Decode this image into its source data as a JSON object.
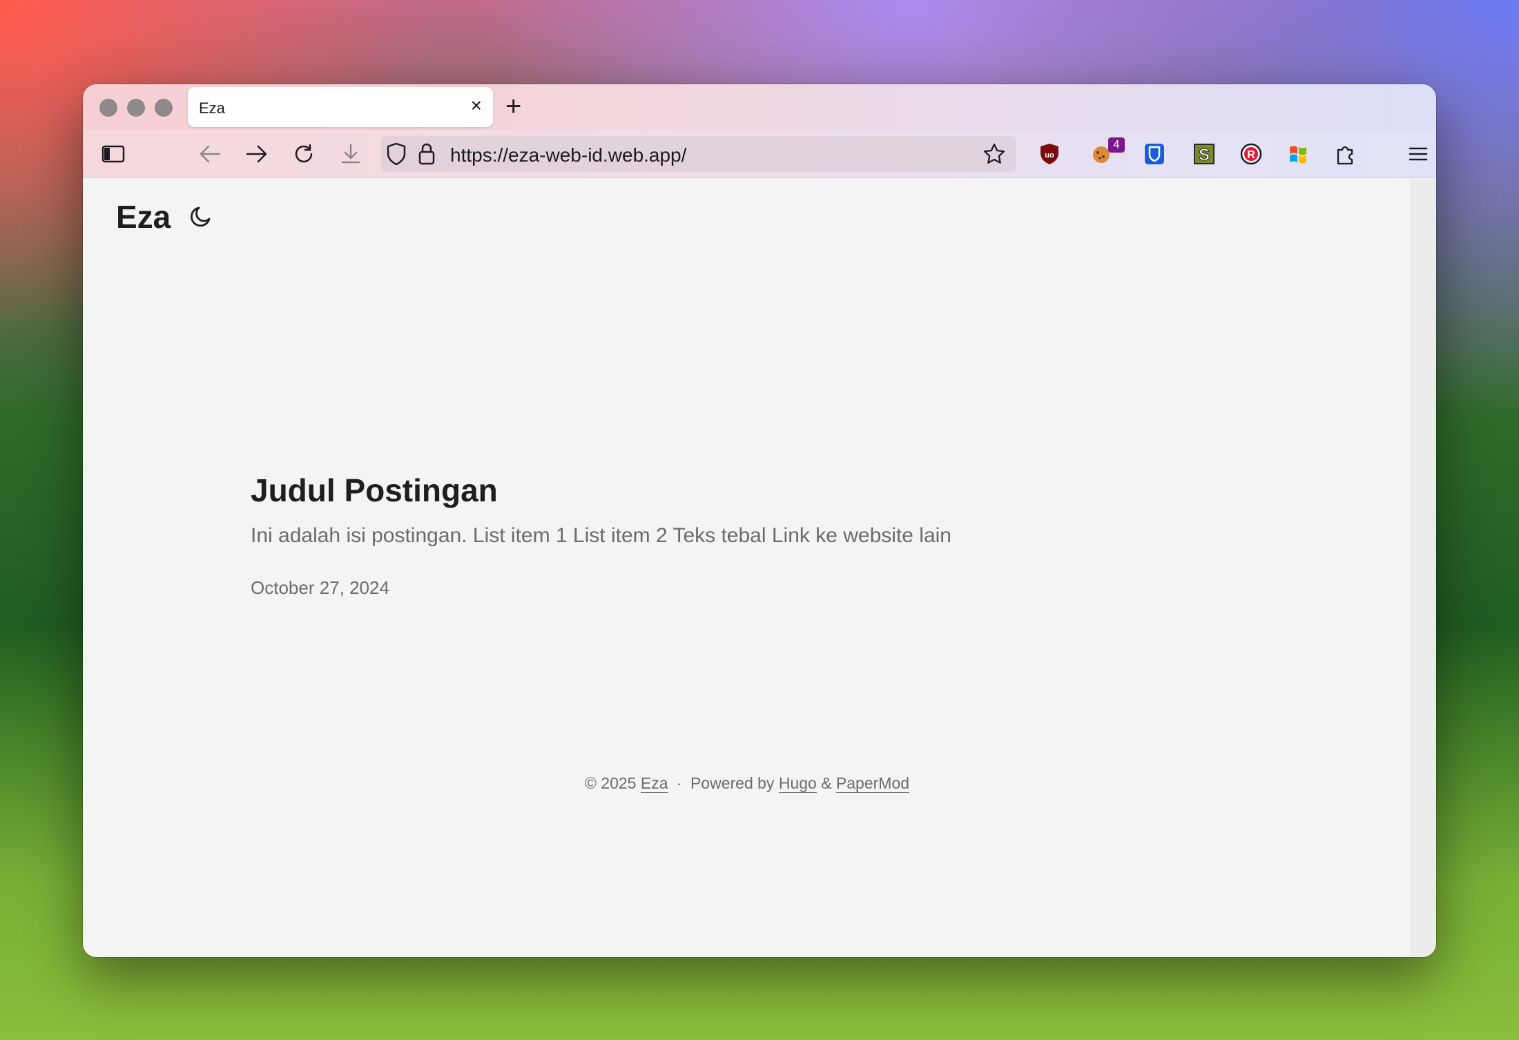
{
  "browser": {
    "tab_title": "Eza",
    "tab_close": "×",
    "new_tab": "+",
    "url": "https://eza-web-id.web.app/",
    "extension_badge": "4"
  },
  "site": {
    "logo": "Eza",
    "theme_icon": "moon-icon"
  },
  "post": {
    "title": "Judul Postingan",
    "excerpt": "Ini adalah isi postingan. List item 1 List item 2 Teks tebal Link ke website lain",
    "date": "October 27, 2024"
  },
  "footer": {
    "copyright": "© 2025",
    "site_link": "Eza",
    "separator": "·",
    "powered_by": "Powered by",
    "hugo": "Hugo",
    "amp": "&",
    "papermod": "PaperMod"
  }
}
